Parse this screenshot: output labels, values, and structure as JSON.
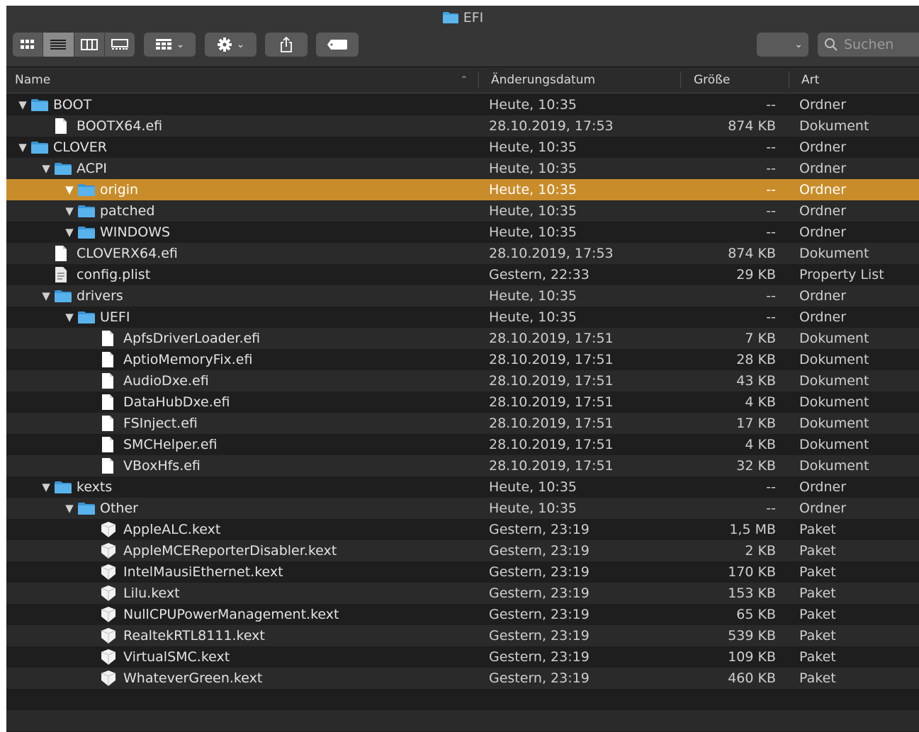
{
  "window": {
    "title": "EFI"
  },
  "toolbar": {
    "search_placeholder": "Suchen"
  },
  "columns": {
    "name": "Name",
    "date": "Änderungsdatum",
    "size": "Größe",
    "kind": "Art"
  },
  "colors": {
    "selection": "#c98c2a",
    "folder": "#3fa2e0"
  },
  "rows": [
    {
      "name": "BOOT",
      "date": "Heute, 10:35",
      "size": "--",
      "kind": "Ordner"
    },
    {
      "name": "BOOTX64.efi",
      "date": "28.10.2019, 17:53",
      "size": "874 KB",
      "kind": "Dokument"
    },
    {
      "name": "CLOVER",
      "date": "Heute, 10:35",
      "size": "--",
      "kind": "Ordner"
    },
    {
      "name": "ACPI",
      "date": "Heute, 10:35",
      "size": "--",
      "kind": "Ordner"
    },
    {
      "name": "origin",
      "date": "Heute, 10:35",
      "size": "--",
      "kind": "Ordner"
    },
    {
      "name": "patched",
      "date": "Heute, 10:35",
      "size": "--",
      "kind": "Ordner"
    },
    {
      "name": "WINDOWS",
      "date": "Heute, 10:35",
      "size": "--",
      "kind": "Ordner"
    },
    {
      "name": "CLOVERX64.efi",
      "date": "28.10.2019, 17:53",
      "size": "874 KB",
      "kind": "Dokument"
    },
    {
      "name": "config.plist",
      "date": "Gestern, 22:33",
      "size": "29 KB",
      "kind": "Property List"
    },
    {
      "name": "drivers",
      "date": "Heute, 10:35",
      "size": "--",
      "kind": "Ordner"
    },
    {
      "name": "UEFI",
      "date": "Heute, 10:35",
      "size": "--",
      "kind": "Ordner"
    },
    {
      "name": "ApfsDriverLoader.efi",
      "date": "28.10.2019, 17:51",
      "size": "7 KB",
      "kind": "Dokument"
    },
    {
      "name": "AptioMemoryFix.efi",
      "date": "28.10.2019, 17:51",
      "size": "28 KB",
      "kind": "Dokument"
    },
    {
      "name": "AudioDxe.efi",
      "date": "28.10.2019, 17:51",
      "size": "43 KB",
      "kind": "Dokument"
    },
    {
      "name": "DataHubDxe.efi",
      "date": "28.10.2019, 17:51",
      "size": "4 KB",
      "kind": "Dokument"
    },
    {
      "name": "FSInject.efi",
      "date": "28.10.2019, 17:51",
      "size": "17 KB",
      "kind": "Dokument"
    },
    {
      "name": "SMCHelper.efi",
      "date": "28.10.2019, 17:51",
      "size": "4 KB",
      "kind": "Dokument"
    },
    {
      "name": "VBoxHfs.efi",
      "date": "28.10.2019, 17:51",
      "size": "32 KB",
      "kind": "Dokument"
    },
    {
      "name": "kexts",
      "date": "Heute, 10:35",
      "size": "--",
      "kind": "Ordner"
    },
    {
      "name": "Other",
      "date": "Heute, 10:35",
      "size": "--",
      "kind": "Ordner"
    },
    {
      "name": "AppleALC.kext",
      "date": "Gestern, 23:19",
      "size": "1,5 MB",
      "kind": "Paket"
    },
    {
      "name": "AppleMCEReporterDisabler.kext",
      "date": "Gestern, 23:19",
      "size": "2 KB",
      "kind": "Paket"
    },
    {
      "name": "IntelMausiEthernet.kext",
      "date": "Gestern, 23:19",
      "size": "170 KB",
      "kind": "Paket"
    },
    {
      "name": "Lilu.kext",
      "date": "Gestern, 23:19",
      "size": "153 KB",
      "kind": "Paket"
    },
    {
      "name": "NullCPUPowerManagement.kext",
      "date": "Gestern, 23:19",
      "size": "65 KB",
      "kind": "Paket"
    },
    {
      "name": "RealtekRTL8111.kext",
      "date": "Gestern, 23:19",
      "size": "539 KB",
      "kind": "Paket"
    },
    {
      "name": "VirtualSMC.kext",
      "date": "Gestern, 23:19",
      "size": "109 KB",
      "kind": "Paket"
    },
    {
      "name": "WhateverGreen.kext",
      "date": "Gestern, 23:19",
      "size": "460 KB",
      "kind": "Paket"
    }
  ]
}
